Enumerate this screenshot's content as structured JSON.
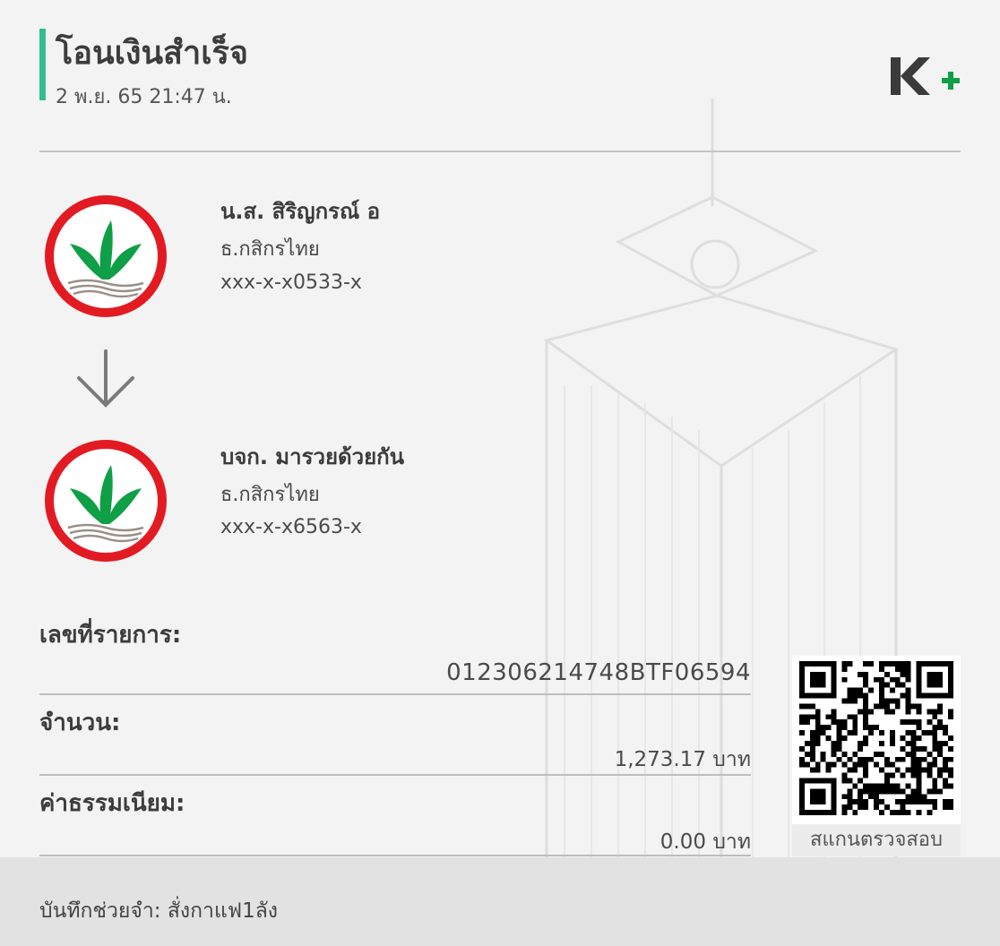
{
  "header": {
    "title": "โอนเงินสำเร็จ",
    "datetime": "2 พ.ย. 65  21:47 น."
  },
  "sender": {
    "name": "น.ส. สิริญกรณ์ อ",
    "bank": "ธ.กสิกรไทย",
    "account": "xxx-x-x0533-x"
  },
  "receiver": {
    "name": "บจก. มารวยด้วยกัน",
    "bank": "ธ.กสิกรไทย",
    "account": "xxx-x-x6563-x"
  },
  "transaction": {
    "ref_label": "เลขที่รายการ:",
    "ref_value": "012306214748BTF06594",
    "amount_label": "จำนวน:",
    "amount_value": "1,273.17 บาท",
    "fee_label": "ค่าธรรมเนียม:",
    "fee_value": "0.00 บาท"
  },
  "qr": {
    "caption": "สแกนตรวจสอบ"
  },
  "footer": {
    "memo": "บันทึกช่วยจำ: สั่งกาแฟ1ลัง"
  },
  "colors": {
    "accent": "#2ebf91",
    "kbank_green": "#0f9f47",
    "kbank_red": "#e21b23"
  },
  "icons": [
    "kbank-logo-icon",
    "down-arrow-icon",
    "kplus-logo-icon",
    "qr-code-icon"
  ]
}
